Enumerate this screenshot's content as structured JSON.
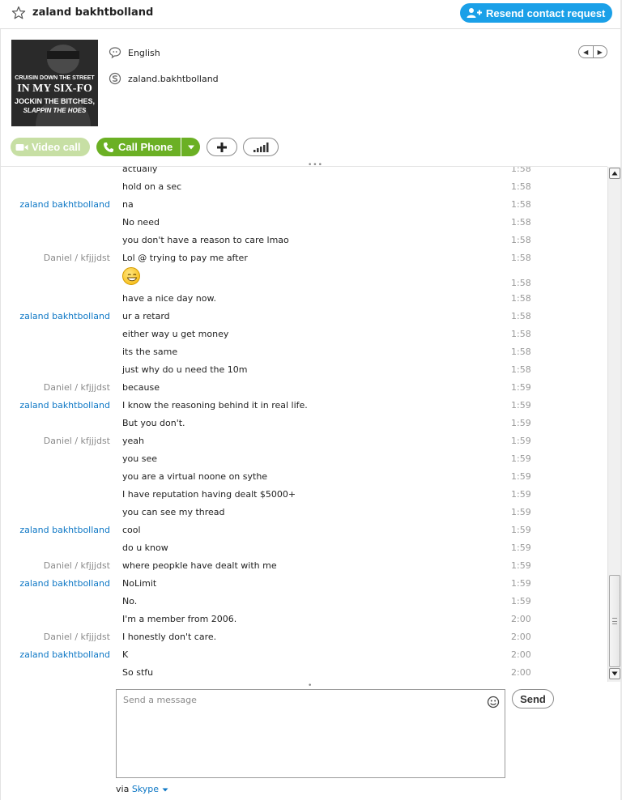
{
  "header": {
    "contact_name": "zaland bakhtbolland",
    "resend_label": "Resend contact request"
  },
  "profile": {
    "avatar_lines": [
      "CRUISIN DOWN THE STREET",
      "IN MY SIX-FO",
      "JOCKIN THE BITCHES,",
      "SLAPPIN THE HOES"
    ],
    "language": "English",
    "skype_name": "zaland.bakhtbolland"
  },
  "call_bar": {
    "video_label": "Video call",
    "call_label": "Call Phone"
  },
  "messages": [
    {
      "sender": "",
      "text": "actually",
      "time": "1:58"
    },
    {
      "sender": "",
      "text": "hold on a sec",
      "time": "1:58"
    },
    {
      "sender": "zaland bakhtbolland",
      "text": "na",
      "time": "1:58"
    },
    {
      "sender": "",
      "text": "No need",
      "time": "1:58"
    },
    {
      "sender": "",
      "text": "you don't have a reason to care lmao",
      "time": "1:58"
    },
    {
      "sender": "Daniel / kfjjjdst",
      "text": "Lol @ trying to pay me after",
      "time": "1:58"
    },
    {
      "sender": "",
      "text": "",
      "time": "1:58",
      "emoji": true
    },
    {
      "sender": "",
      "text": "have a nice day now.",
      "time": "1:58"
    },
    {
      "sender": "zaland bakhtbolland",
      "text": "ur a retard",
      "time": "1:58"
    },
    {
      "sender": "",
      "text": "either way u get money",
      "time": "1:58"
    },
    {
      "sender": "",
      "text": "its the same",
      "time": "1:58"
    },
    {
      "sender": "",
      "text": "just why do u need the 10m",
      "time": "1:58"
    },
    {
      "sender": "Daniel / kfjjjdst",
      "text": "because",
      "time": "1:59"
    },
    {
      "sender": "zaland bakhtbolland",
      "text": "I know the reasoning behind it in real life.",
      "time": "1:59"
    },
    {
      "sender": "",
      "text": "But you don't.",
      "time": "1:59"
    },
    {
      "sender": "Daniel / kfjjjdst",
      "text": "yeah",
      "time": "1:59"
    },
    {
      "sender": "",
      "text": "you see",
      "time": "1:59"
    },
    {
      "sender": "",
      "text": "you are a virtual noone on sythe",
      "time": "1:59"
    },
    {
      "sender": "",
      "text": "I have reputation having dealt $5000+",
      "time": "1:59"
    },
    {
      "sender": "",
      "text": "you can see my thread",
      "time": "1:59"
    },
    {
      "sender": "zaland bakhtbolland",
      "text": "cool",
      "time": "1:59"
    },
    {
      "sender": "",
      "text": "do u know",
      "time": "1:59"
    },
    {
      "sender": "Daniel / kfjjjdst",
      "text": "where peopkle have dealt with me",
      "time": "1:59"
    },
    {
      "sender": "zaland bakhtbolland",
      "text": "NoLimit",
      "time": "1:59"
    },
    {
      "sender": "",
      "text": "No.",
      "time": "1:59"
    },
    {
      "sender": "",
      "text": "I'm a member from 2006.",
      "time": "2:00"
    },
    {
      "sender": "Daniel / kfjjjdst",
      "text": "I honestly don't care.",
      "time": "2:00"
    },
    {
      "sender": "zaland bakhtbolland",
      "text": "K",
      "time": "2:00"
    },
    {
      "sender": "",
      "text": "So stfu",
      "time": "2:00"
    }
  ],
  "composer": {
    "placeholder": "Send a message",
    "send_label": "Send",
    "via_label": "via",
    "via_service": "Skype"
  },
  "colors": {
    "accent_blue": "#1aa0e8",
    "call_green": "#6bb024",
    "video_green_disabled": "#c7dfa4",
    "me_sender": "#0d77c5",
    "other_sender": "#8a8a8a"
  }
}
